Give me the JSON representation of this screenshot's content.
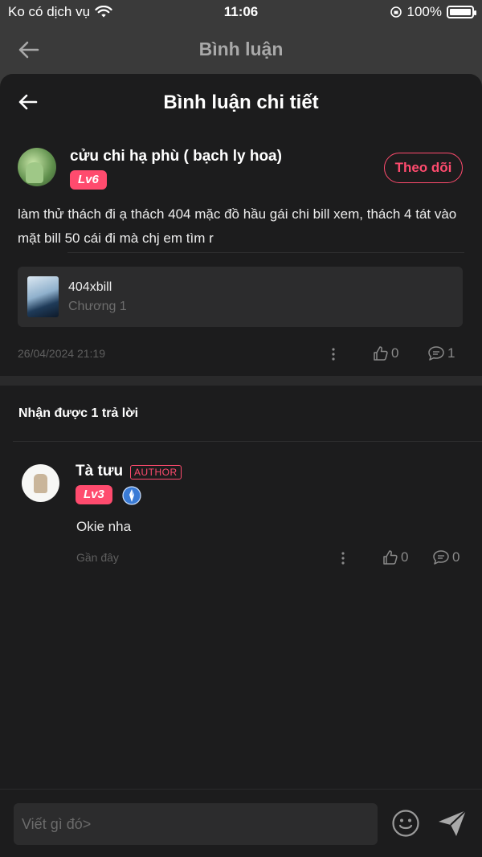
{
  "status_bar": {
    "carrier": "Ko có dịch vụ",
    "time": "11:06",
    "battery": "100%"
  },
  "background_header": {
    "title": "Bình luận"
  },
  "sheet": {
    "title": "Bình luận chi tiết"
  },
  "comment": {
    "username": "cửu chi hạ phù ( bạch ly hoa)",
    "level": "Lv6",
    "follow_label": "Theo dõi",
    "text": "làm thử thách đi ạ thách 404 mặc đồ hầu gái chi bill xem, thách 4 tát vào mặt bill 50 cái đi mà chj em tìm r",
    "chapter": {
      "name": "404xbill",
      "subtitle": "Chương 1"
    },
    "timestamp": "26/04/2024 21:19",
    "likes": "0",
    "replies": "1"
  },
  "replies_header": "Nhận được 1 trả lời",
  "reply": {
    "username": "Tà tưu",
    "author_tag": "AUTHOR",
    "level": "Lv3",
    "text": "Okie nha",
    "time": "Gần đây",
    "likes": "0",
    "replies": "0"
  },
  "input": {
    "placeholder": "Viết gì đó>"
  },
  "colors": {
    "accent": "#ff4b6e",
    "sheet_bg": "#1c1c1d",
    "card_bg": "#2c2c2d"
  },
  "icons": [
    "wifi-icon",
    "back-arrow-icon",
    "more-vertical-icon",
    "thumb-up-icon",
    "comment-icon",
    "vip-badge-icon",
    "emoji-icon",
    "send-icon"
  ]
}
